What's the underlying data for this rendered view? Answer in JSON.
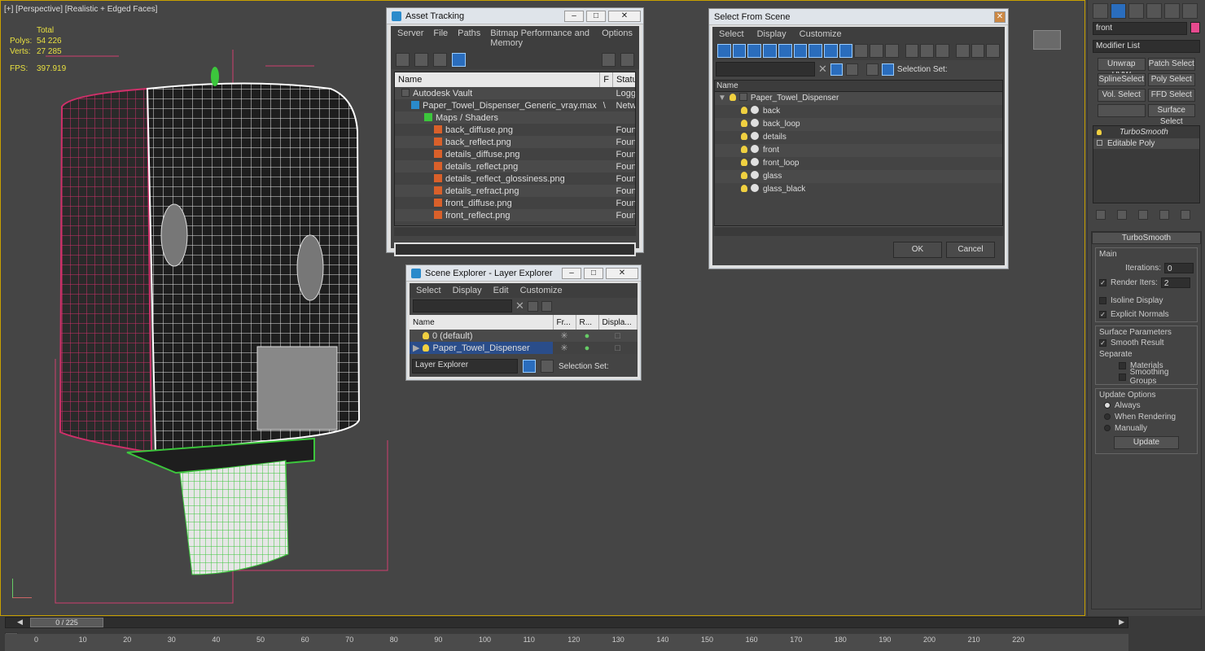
{
  "viewport": {
    "label": "[+] [Perspective] [Realistic + Edged Faces]",
    "stats": {
      "total_label": "Total",
      "polys_label": "Polys:",
      "polys": "54 226",
      "verts_label": "Verts:",
      "verts": "27 285",
      "fps_label": "FPS:",
      "fps": "397.919"
    }
  },
  "asset_tracking": {
    "title": "Asset Tracking",
    "menu": [
      "Server",
      "File",
      "Paths",
      "Bitmap Performance and Memory",
      "Options"
    ],
    "columns": [
      "Name",
      "F",
      "Status"
    ],
    "rows": [
      {
        "name": "Autodesk Vault",
        "f": "",
        "status": "Logged O"
      },
      {
        "name": "Paper_Towel_Dispenser_Generic_vray.max",
        "f": "\\",
        "status": "Network I"
      },
      {
        "name": "Maps / Shaders",
        "f": "",
        "status": ""
      },
      {
        "name": "back_diffuse.png",
        "f": "",
        "status": "Found"
      },
      {
        "name": "back_reflect.png",
        "f": "",
        "status": "Found"
      },
      {
        "name": "details_diffuse.png",
        "f": "",
        "status": "Found"
      },
      {
        "name": "details_reflect.png",
        "f": "",
        "status": "Found"
      },
      {
        "name": "details_reflect_glossiness.png",
        "f": "",
        "status": "Found"
      },
      {
        "name": "details_refract.png",
        "f": "",
        "status": "Found"
      },
      {
        "name": "front_diffuse.png",
        "f": "",
        "status": "Found"
      },
      {
        "name": "front_reflect.png",
        "f": "",
        "status": "Found"
      }
    ]
  },
  "scene_explorer": {
    "title": "Scene Explorer - Layer Explorer",
    "menu": [
      "Select",
      "Display",
      "Edit",
      "Customize"
    ],
    "columns": [
      "Name",
      "Fr...",
      "R...",
      "Displa..."
    ],
    "rows": [
      "0 (default)",
      "Paper_Towel_Dispenser"
    ],
    "footer_dropdown": "Layer Explorer",
    "selection_set_label": "Selection Set:"
  },
  "select_from_scene": {
    "title": "Select From Scene",
    "menu": [
      "Select",
      "Display",
      "Customize"
    ],
    "selection_set_label": "Selection Set:",
    "column": "Name",
    "root": "Paper_Towel_Dispenser",
    "children": [
      "back",
      "back_loop",
      "details",
      "front",
      "front_loop",
      "glass",
      "glass_black"
    ],
    "ok": "OK",
    "cancel": "Cancel"
  },
  "command_panel": {
    "object_name": "front",
    "modifier_list": "Modifier List",
    "buttons": [
      "Unwrap UVW",
      "Patch Select",
      "SplineSelect",
      "Poly Select",
      "Vol. Select",
      "FFD Select",
      "",
      "Surface Select"
    ],
    "stack": [
      "TurboSmooth",
      "Editable Poly"
    ],
    "rollout_title": "TurboSmooth",
    "main_label": "Main",
    "iterations_label": "Iterations:",
    "iterations": "0",
    "render_iters_label": "Render Iters:",
    "render_iters": "2",
    "isoline_label": "Isoline Display",
    "explicit_normals_label": "Explicit Normals",
    "surface_params_label": "Surface Parameters",
    "smooth_result_label": "Smooth Result",
    "separate_label": "Separate",
    "materials_label": "Materials",
    "smoothing_groups_label": "Smoothing Groups",
    "update_options_label": "Update Options",
    "always_label": "Always",
    "when_rendering_label": "When Rendering",
    "manually_label": "Manually",
    "update_button": "Update"
  },
  "timeline": {
    "frame": "0 / 225",
    "ticks": [
      "0",
      "10",
      "20",
      "30",
      "40",
      "50",
      "60",
      "70",
      "80",
      "90",
      "100",
      "110",
      "120",
      "130",
      "140",
      "150",
      "160",
      "170",
      "180",
      "190",
      "200",
      "210",
      "220"
    ]
  }
}
